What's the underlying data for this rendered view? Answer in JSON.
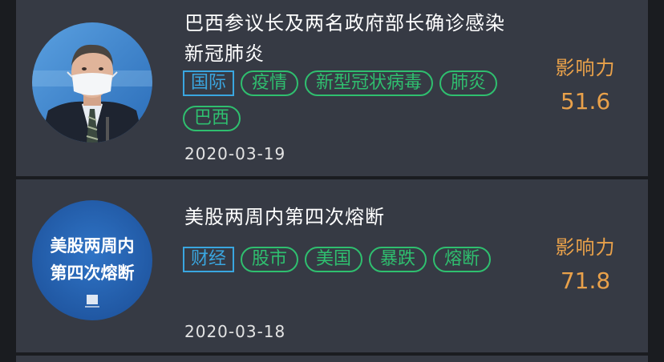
{
  "news": [
    {
      "title": "巴西参议长及两名政府部长确诊感染新冠肺炎",
      "category": "国际",
      "tags": [
        "疫情",
        "新型冠状病毒",
        "肺炎",
        "巴西"
      ],
      "date": "2020-03-19",
      "impact_label": "影响力",
      "impact_value": "51.6"
    },
    {
      "title": "美股两周内第四次熔断",
      "category": "财经",
      "tags": [
        "股市",
        "美国",
        "暴跌",
        "熔断"
      ],
      "date": "2020-03-18",
      "impact_label": "影响力",
      "impact_value": "71.8",
      "thumbnail_text": [
        "美股两周内",
        "第四次熔断"
      ]
    }
  ],
  "colors": {
    "background": "#1a1c20",
    "card": "#363a44",
    "category_tag": "#3aa6e0",
    "keyword_tag": "#2fbf6f",
    "impact": "#e9a14a"
  }
}
